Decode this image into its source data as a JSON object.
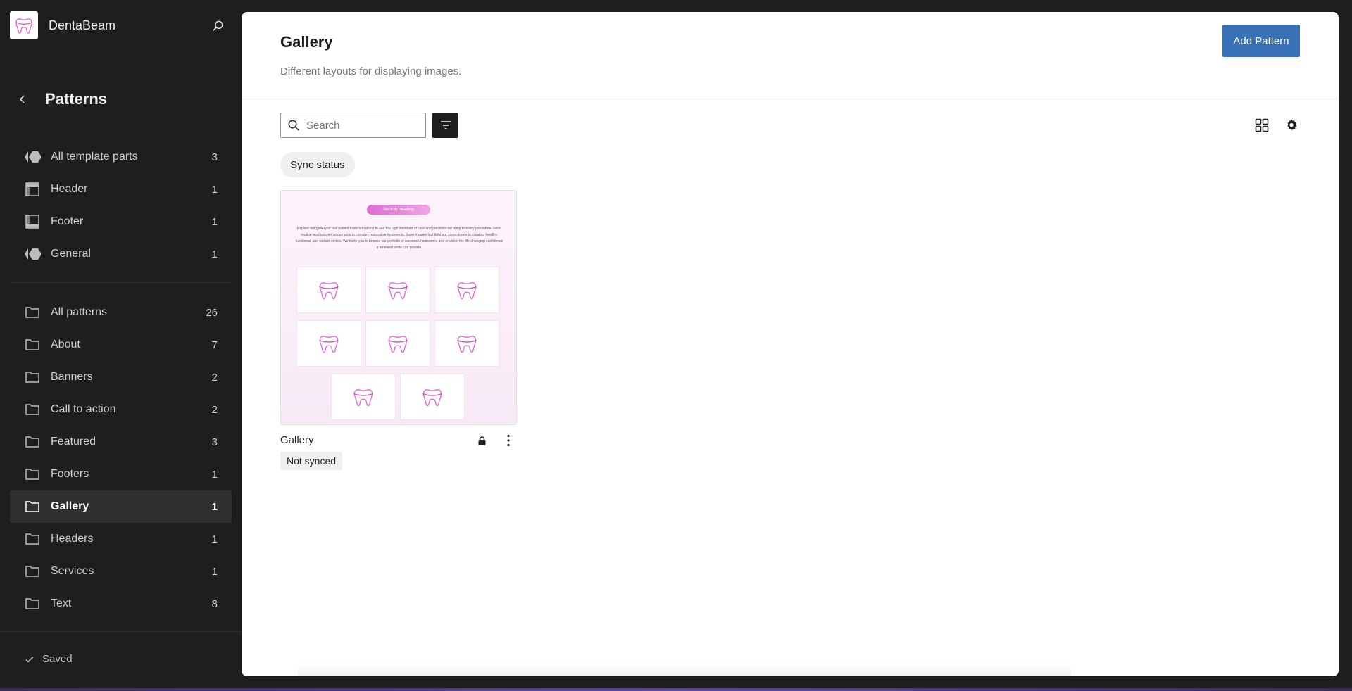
{
  "site": {
    "name": "DentaBeam"
  },
  "section": {
    "title": "Patterns"
  },
  "template_parts": [
    {
      "label": "All template parts",
      "count": "3",
      "icon": "symbol-icon"
    },
    {
      "label": "Header",
      "count": "1",
      "icon": "header-icon"
    },
    {
      "label": "Footer",
      "count": "1",
      "icon": "footer-icon"
    },
    {
      "label": "General",
      "count": "1",
      "icon": "symbol-icon"
    }
  ],
  "categories": [
    {
      "label": "All patterns",
      "count": "26"
    },
    {
      "label": "About",
      "count": "7"
    },
    {
      "label": "Banners",
      "count": "2"
    },
    {
      "label": "Call to action",
      "count": "2"
    },
    {
      "label": "Featured",
      "count": "3"
    },
    {
      "label": "Footers",
      "count": "1"
    },
    {
      "label": "Gallery",
      "count": "1",
      "active": true
    },
    {
      "label": "Headers",
      "count": "1"
    },
    {
      "label": "Services",
      "count": "1"
    },
    {
      "label": "Text",
      "count": "8"
    }
  ],
  "status": {
    "saved": "Saved"
  },
  "main": {
    "title": "Gallery",
    "description": "Different layouts for displaying images.",
    "add_button": "Add Pattern",
    "search": {
      "placeholder": "Search",
      "value": ""
    },
    "filter_chip": "Sync status"
  },
  "patterns": [
    {
      "title": "Gallery",
      "badge": "Not synced",
      "preview": {
        "heading": "Section Heading",
        "text": "Explore our gallery of real patient transformations to see the high standard of care and precision we bring to every procedure. From routine aesthetic enhancements to complex restorative treatments, these images highlight our commitment to creating healthy, functional, and radiant smiles. We invite you to browse our portfolio of successful outcomes and envision the life-changing confidence a renewed smile can provide."
      }
    }
  ],
  "colors": {
    "accent": "#3871b6",
    "sidebar_bg": "#1e1e1e",
    "active_item_bg": "#2f2f2f",
    "preview_pink": "#e06bd3"
  }
}
